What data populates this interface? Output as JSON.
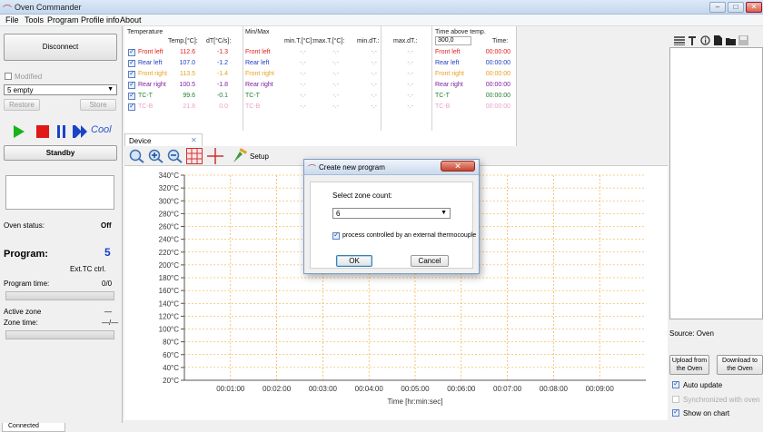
{
  "window": {
    "title": "Oven Commander",
    "min": "–",
    "max": "□",
    "close": "✕"
  },
  "menu": [
    "File",
    "Tools",
    "Program",
    "Profile info",
    "About"
  ],
  "left": {
    "disconnect": "Disconnect",
    "modified": "Modified",
    "program_select": "5 empty",
    "restore": "Restore",
    "store": "Store",
    "cool_label": "Cool",
    "state": "Standby",
    "oven_status_label": "Oven status:",
    "oven_status_value": "Off",
    "program_label": "Program:",
    "program_value": "5",
    "ext_tc": "Ext.TC ctrl.",
    "program_time_label": "Program time:",
    "program_time_value": "0/0",
    "active_zone_label": "Active zone",
    "active_zone_value": "—",
    "zone_time_label": "Zone time:",
    "zone_time_value": "—/—"
  },
  "sensors": {
    "headers": {
      "temperature": "Temperature",
      "temp_c": "Temp.[°C]:",
      "dt": "dT[°C/s]:",
      "minmax": "Min/Max",
      "min_t": "min.T.[°C]:",
      "max_t": "max.T.[°C]:",
      "min_dt": "min.dT.:",
      "max_dt": "max.dT.:",
      "time_above": "Time above temp.",
      "threshold": "300,0",
      "time": "Time:"
    },
    "rows": [
      {
        "name": "Front left",
        "temp": "112.6",
        "dt": "-1.3",
        "minmax": "Front left",
        "min": "-.-",
        "max": "-.-",
        "mindt": "-.-",
        "maxdt": "-.-",
        "ta_name": "Front left",
        "time": "00:00:00",
        "color": "#e02020",
        "checked": true
      },
      {
        "name": "Rear left",
        "temp": "107.0",
        "dt": "-1.2",
        "minmax": "Rear left",
        "min": "-.-",
        "max": "-.-",
        "mindt": "-.-",
        "maxdt": "-.-",
        "ta_name": "Rear left",
        "time": "00:00:00",
        "color": "#2040c0",
        "checked": true
      },
      {
        "name": "Front right",
        "temp": "113.5",
        "dt": "-1.4",
        "minmax": "Front right",
        "min": "-.-",
        "max": "-.-",
        "mindt": "-.-",
        "maxdt": "-.-",
        "ta_name": "Front right",
        "time": "00:00:00",
        "color": "#e8a020",
        "checked": true
      },
      {
        "name": "Rear right",
        "temp": "100.5",
        "dt": "-1.8",
        "minmax": "Rear right",
        "min": "-.-",
        "max": "-.-",
        "mindt": "-.-",
        "maxdt": "-.-",
        "ta_name": "Rear right",
        "time": "00:00:00",
        "color": "#8020a0",
        "checked": true
      },
      {
        "name": "TC-T",
        "temp": "99.6",
        "dt": "-0.1",
        "minmax": "TC-T",
        "min": "-.-",
        "max": "-.-",
        "mindt": "-.-",
        "maxdt": "-.-",
        "ta_name": "TC-T",
        "time": "00:00:00",
        "color": "#208030",
        "checked": true
      },
      {
        "name": "TC-B",
        "temp": "21.8",
        "dt": "0.0",
        "minmax": "TC-B",
        "min": "-.-",
        "max": "-.-",
        "mindt": "-.-",
        "maxdt": "-.-",
        "ta_name": "TC-B",
        "time": "00:00:00",
        "color": "#e070b0",
        "checked": true,
        "dim": true
      }
    ]
  },
  "device_tab": "Device",
  "device_tab_close": "✕",
  "toolbar": {
    "setup": "Setup"
  },
  "chart": {
    "y_ticks": [
      "340°C",
      "320°C",
      "300°C",
      "280°C",
      "260°C",
      "240°C",
      "220°C",
      "200°C",
      "180°C",
      "160°C",
      "140°C",
      "120°C",
      "100°C",
      "80°C",
      "60°C",
      "40°C",
      "20°C"
    ],
    "x_ticks": [
      "00:01:00",
      "00:02:00",
      "00:03:00",
      "00:04:00",
      "00:05:00",
      "00:06:00",
      "00:07:00",
      "00:08:00",
      "00:09:00"
    ],
    "x_label": "Time [hr:min:sec]"
  },
  "dialog": {
    "title": "Create new program",
    "close": "✕",
    "zone_label": "Select zone count:",
    "zone_value": "6",
    "ext_tc_label": "process controlled by an external thermocouple",
    "ok": "OK",
    "cancel": "Cancel"
  },
  "right": {
    "source": "Source: Oven",
    "upload": "Upload from the Oven",
    "download": "Download to the Oven",
    "auto_update": "Auto update",
    "sync": "Synchronized with oven",
    "show_chart": "Show on chart"
  },
  "bottom_tab": "Connected"
}
